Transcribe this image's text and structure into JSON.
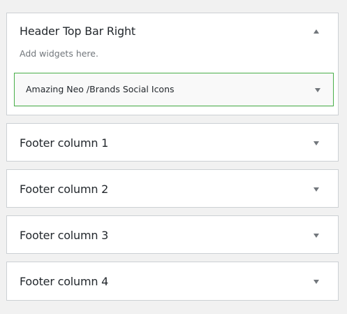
{
  "sidebars": [
    {
      "title": "Header Top Bar Right",
      "expanded": true,
      "description": "Add widgets here.",
      "widgets": [
        {
          "title": "Amazing Neo /Brands Social Icons"
        }
      ]
    },
    {
      "title": "Footer column 1",
      "expanded": false
    },
    {
      "title": "Footer column 2",
      "expanded": false
    },
    {
      "title": "Footer column 3",
      "expanded": false
    },
    {
      "title": "Footer column 4",
      "expanded": false
    }
  ],
  "colors": {
    "background": "#f1f1f1",
    "panel_border": "#ccd0d4",
    "widget_highlight": "#4ab04a",
    "arrow": "#72777c"
  }
}
